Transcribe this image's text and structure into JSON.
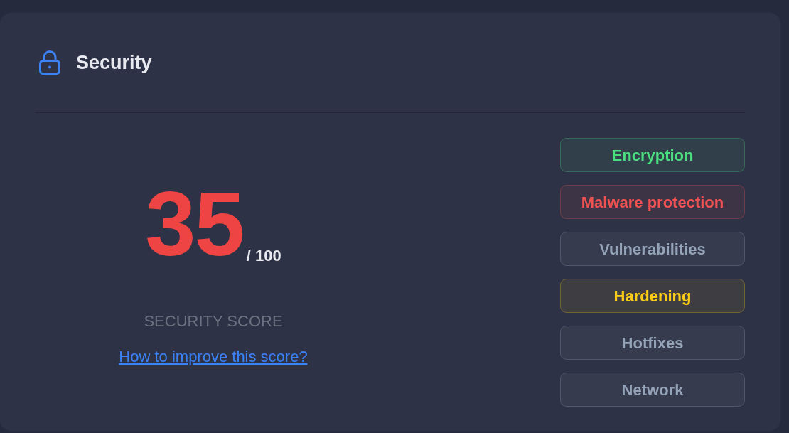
{
  "panel": {
    "title": "Security"
  },
  "score": {
    "value": "35",
    "max": "/ 100",
    "label": "SECURITY SCORE",
    "link": "How to improve this score?"
  },
  "checks": [
    {
      "label": "Encryption",
      "color": "#4ade80"
    },
    {
      "label": "Malware protection",
      "color": "#f05252"
    },
    {
      "label": "Vulnerabilities",
      "color": "#94a3b8"
    },
    {
      "label": "Hardening",
      "color": "#facc15"
    },
    {
      "label": "Hotfixes",
      "color": "#94a3b8"
    },
    {
      "label": "Network",
      "color": "#94a3b8"
    }
  ]
}
